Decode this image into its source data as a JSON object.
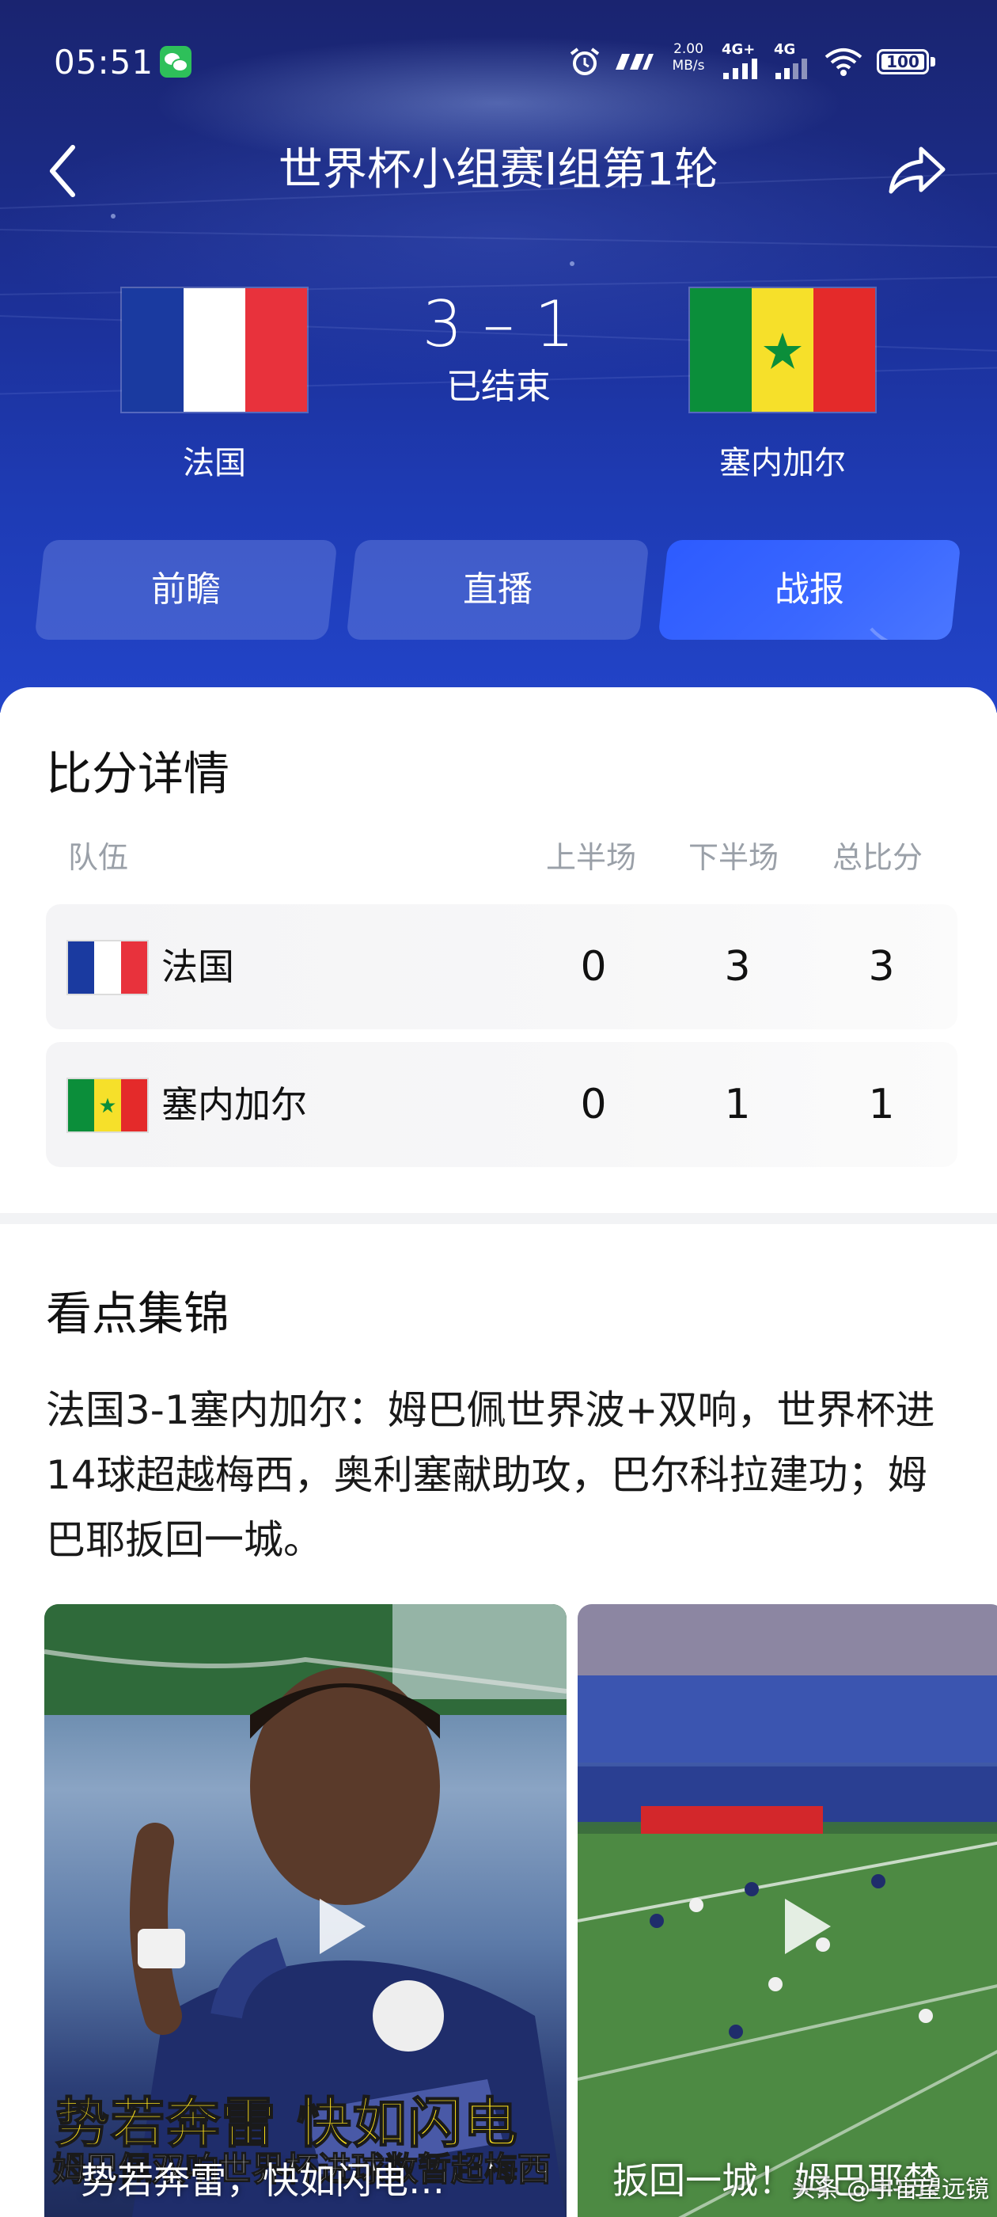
{
  "status_bar": {
    "time": "05:51",
    "network_speed": "2.00\nMB/s",
    "signal1": "4G+",
    "signal2": "4G",
    "battery": "100"
  },
  "header": {
    "title": "世界杯小组赛I组第1轮",
    "home_team": "法国",
    "away_team": "塞内加尔",
    "score": "3 – 1",
    "status": "已结束"
  },
  "tabs": [
    {
      "label": "前瞻"
    },
    {
      "label": "直播"
    },
    {
      "label": "战报"
    }
  ],
  "score_detail": {
    "title": "比分详情",
    "columns": [
      "队伍",
      "上半场",
      "下半场",
      "总比分"
    ],
    "rows": [
      {
        "team": "法国",
        "first_half": "0",
        "second_half": "3",
        "total": "3"
      },
      {
        "team": "塞内加尔",
        "first_half": "0",
        "second_half": "1",
        "total": "1"
      }
    ]
  },
  "highlights": {
    "title": "看点集锦",
    "description": "法国3-1塞内加尔：姆巴佩世界波+双响，世界杯进14球超越梅西，奥利塞献助攻，巴尔科拉建功；姆巴耶扳回一城。",
    "videos": [
      {
        "caption": "势若奔雷，快如闪电…",
        "promo": "势若奔雷 快如闪电",
        "promo_sub": "姆巴佩双响世界杯进球数暂超梅西"
      },
      {
        "caption": "扳回一城！姆巴耶禁",
        "watermark": "头条 @宇宙望远镜"
      }
    ]
  },
  "colors": {
    "accent": "#2d5bff",
    "france_blue": "#1a3aa0",
    "france_red": "#e8323c",
    "senegal_green": "#0b8e3a",
    "senegal_yellow": "#f6e02a",
    "senegal_red": "#e42a2a"
  }
}
